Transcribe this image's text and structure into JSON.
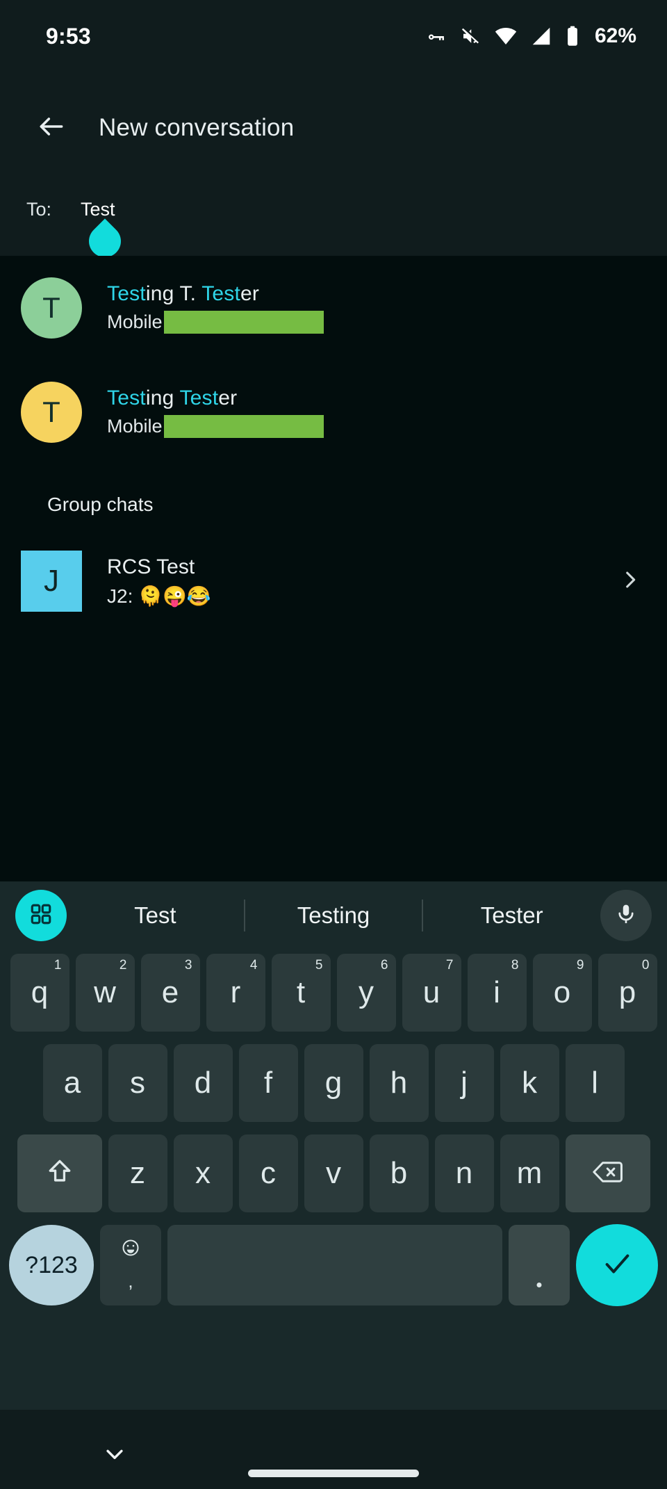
{
  "status_bar": {
    "time": "9:53",
    "battery_percent": "62%",
    "icons": [
      "vpn-key-icon",
      "volume-off-icon",
      "wifi-icon",
      "cellular-signal-icon",
      "battery-icon"
    ]
  },
  "app_bar": {
    "back_icon": "arrow-back-icon",
    "title": "New conversation"
  },
  "to_field": {
    "label": "To:",
    "value": "Test",
    "cursor_handle_icon": "text-cursor-handle-icon"
  },
  "contacts": [
    {
      "avatar_letter": "T",
      "avatar_color": "#8ccf99",
      "name_parts": [
        {
          "text": "Test",
          "highlight": true
        },
        {
          "text": "ing T. ",
          "highlight": false
        },
        {
          "text": "Test",
          "highlight": true
        },
        {
          "text": "er",
          "highlight": false
        }
      ],
      "phone_label": "Mobile",
      "phone_number": ""
    },
    {
      "avatar_letter": "T",
      "avatar_color": "#f6d35f",
      "name_parts": [
        {
          "text": "Test",
          "highlight": true
        },
        {
          "text": "ing ",
          "highlight": false
        },
        {
          "text": "Test",
          "highlight": true
        },
        {
          "text": "er",
          "highlight": false
        }
      ],
      "phone_label": "Mobile",
      "phone_number": ""
    }
  ],
  "group_section": {
    "title": "Group chats",
    "items": [
      {
        "avatar_letter": "J",
        "avatar_color": "#58cdec",
        "name": "RCS Test",
        "preview": "J2: 🫠😜😂",
        "chevron_icon": "chevron-right-icon"
      }
    ]
  },
  "keyboard": {
    "apps_icon": "grid-apps-icon",
    "mic_icon": "microphone-icon",
    "suggestions": [
      "Test",
      "Testing",
      "Tester"
    ],
    "row1": [
      {
        "key": "q",
        "num": "1"
      },
      {
        "key": "w",
        "num": "2"
      },
      {
        "key": "e",
        "num": "3"
      },
      {
        "key": "r",
        "num": "4"
      },
      {
        "key": "t",
        "num": "5"
      },
      {
        "key": "y",
        "num": "6"
      },
      {
        "key": "u",
        "num": "7"
      },
      {
        "key": "i",
        "num": "8"
      },
      {
        "key": "o",
        "num": "9"
      },
      {
        "key": "p",
        "num": "0"
      }
    ],
    "row2": [
      "a",
      "s",
      "d",
      "f",
      "g",
      "h",
      "j",
      "k",
      "l"
    ],
    "row3": [
      "z",
      "x",
      "c",
      "v",
      "b",
      "n",
      "m"
    ],
    "shift_icon": "shift-arrow-icon",
    "backspace_icon": "backspace-icon",
    "symbols_label": "?123",
    "emoji_icon": "emoji-smiley-icon",
    "comma_label": ",",
    "space_label": "",
    "period_label": ".",
    "enter_icon": "checkmark-icon"
  },
  "nav_bar": {
    "hide_keyboard_icon": "chevron-down-icon",
    "home_pill_icon": "home-gesture-pill"
  },
  "colors": {
    "accent_cyan": "#12dcdc",
    "highlight_cyan": "#2fd5e8",
    "redaction_green": "#76bc43",
    "header_bg": "#101c1d",
    "list_bg": "#020d0d",
    "keyboard_bg": "#19292a"
  }
}
